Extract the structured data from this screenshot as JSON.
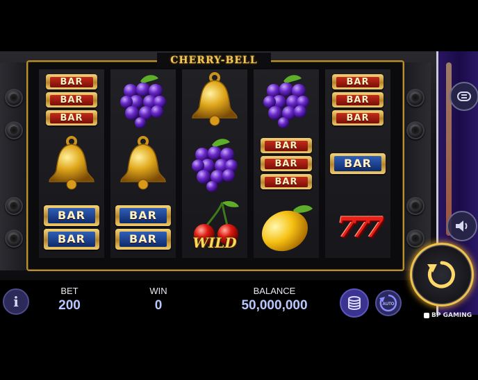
{
  "game": {
    "title": "CHERRY-BELL",
    "brand": "BP GAMING"
  },
  "stats": {
    "bet_label": "BET",
    "bet_value": "200",
    "win_label": "WIN",
    "win_value": "0",
    "balance_label": "BALANCE",
    "balance_value": "50,000,000"
  },
  "buttons": {
    "info_label": "i",
    "auto_label": "AUTO"
  },
  "symbols": {
    "bar_text": "BAR",
    "wild_text": "WILD",
    "seven_text": "777"
  },
  "reels": [
    [
      "bar-triple-red",
      "bell",
      "bar-double-blue"
    ],
    [
      "grapes",
      "bell",
      "bar-double-blue"
    ],
    [
      "bell",
      "grapes",
      "cherry-wild"
    ],
    [
      "grapes",
      "bar-triple-red",
      "lemon"
    ],
    [
      "bar-triple-red",
      "bar-single-blue",
      "seven"
    ]
  ],
  "colors": {
    "frame_gold": "#b8902e",
    "accent_purple": "#2a1560",
    "value_blue": "#b9c7ff"
  }
}
